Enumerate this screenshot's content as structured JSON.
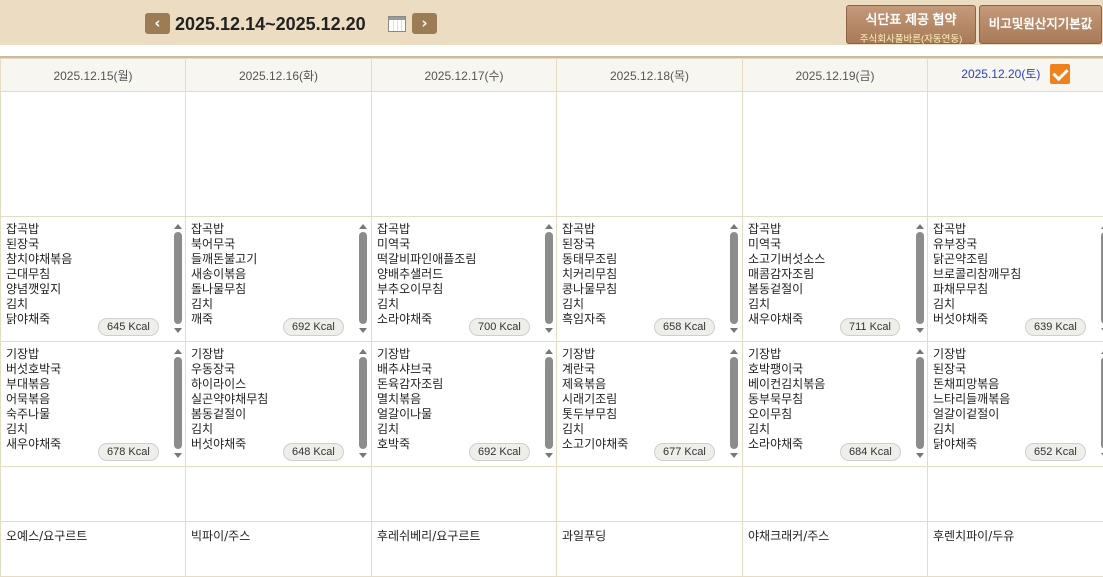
{
  "nav": {
    "prev_label": "‹",
    "next_label": "›",
    "date_range": "2025.12.14~2025.12.20",
    "prev_icon": "chevron-left-icon",
    "next_icon": "chevron-right-icon",
    "calendar_icon": "calendar-icon"
  },
  "buttons": {
    "diet_line1": "식단표 제공 협약",
    "diet_line2": "주식회사풀바른(자동연동)",
    "origin": "비고및원산지기본값"
  },
  "days": [
    {
      "date": "2025.12.15(월)",
      "lunch": [
        "잡곡밥",
        "된장국",
        "참치야채볶음",
        "근대무침",
        "양념깻잎지",
        "김치",
        "닭야채죽"
      ],
      "lunch_kcal": "645 Kcal",
      "dinner": [
        "기장밥",
        "버섯호박국",
        "부대볶음",
        "어묵볶음",
        "숙주나물",
        "김치",
        "새우야채죽"
      ],
      "dinner_kcal": "678 Kcal",
      "snack": "오예스/요구르트"
    },
    {
      "date": "2025.12.16(화)",
      "lunch": [
        "잡곡밥",
        "북어무국",
        "들깨돈불고기",
        "새송이볶음",
        "돌나물무침",
        "김치",
        "깨죽"
      ],
      "lunch_kcal": "692 Kcal",
      "dinner": [
        "기장밥",
        "우동장국",
        "하이라이스",
        "실곤약야채무침",
        "봄동겉절이",
        "김치",
        "버섯야채죽"
      ],
      "dinner_kcal": "648 Kcal",
      "snack": "빅파이/주스"
    },
    {
      "date": "2025.12.17(수)",
      "lunch": [
        "잡곡밥",
        "미역국",
        "떡갈비파인애플조림",
        "양배추샐러드",
        "부추오이무침",
        "김치",
        "소라야채죽"
      ],
      "lunch_kcal": "700 Kcal",
      "dinner": [
        "기장밥",
        "배추샤브국",
        "돈육감자조림",
        "멸치볶음",
        "얼갈이나물",
        "김치",
        "호박죽"
      ],
      "dinner_kcal": "692 Kcal",
      "snack": "후레쉬베리/요구르트"
    },
    {
      "date": "2025.12.18(목)",
      "lunch": [
        "잡곡밥",
        "된장국",
        "동태무조림",
        "치커리무침",
        "콩나물무침",
        "김치",
        "흑임자죽"
      ],
      "lunch_kcal": "658 Kcal",
      "dinner": [
        "기장밥",
        "계란국",
        "제육볶음",
        "시래기조림",
        "톳두부무침",
        "김치",
        "소고기야채죽"
      ],
      "dinner_kcal": "677 Kcal",
      "snack": "과일푸딩"
    },
    {
      "date": "2025.12.19(금)",
      "lunch": [
        "잡곡밥",
        "미역국",
        "소고기버섯소스",
        "매콤감자조림",
        "봄동겉절이",
        "김치",
        "새우야채죽"
      ],
      "lunch_kcal": "711 Kcal",
      "dinner": [
        "기장밥",
        "호박팽이국",
        "베이컨김치볶음",
        "동부묵무침",
        "오이무침",
        "김치",
        "소라야채죽"
      ],
      "dinner_kcal": "684 Kcal",
      "snack": "야채크래커/주스"
    },
    {
      "date": "2025.12.20(토)",
      "lunch": [
        "잡곡밥",
        "유부장국",
        "닭곤약조림",
        "브로콜리참깨무침",
        "파채무무침",
        "김치",
        "버섯야채죽"
      ],
      "lunch_kcal": "639 Kcal",
      "dinner": [
        "기장밥",
        "된장국",
        "돈채피망볶음",
        "느타리들깨볶음",
        "얼갈이겉절이",
        "김치",
        "닭야채죽"
      ],
      "dinner_kcal": "652 Kcal",
      "snack": "후렌치파이/두유"
    }
  ],
  "colors": {
    "topbar": "#ecdcc2",
    "accent_brown": "#9c7c55",
    "saturday_blue": "#2a3fc8",
    "checkbox_orange": "#f0821e"
  },
  "saturday_checked": true
}
